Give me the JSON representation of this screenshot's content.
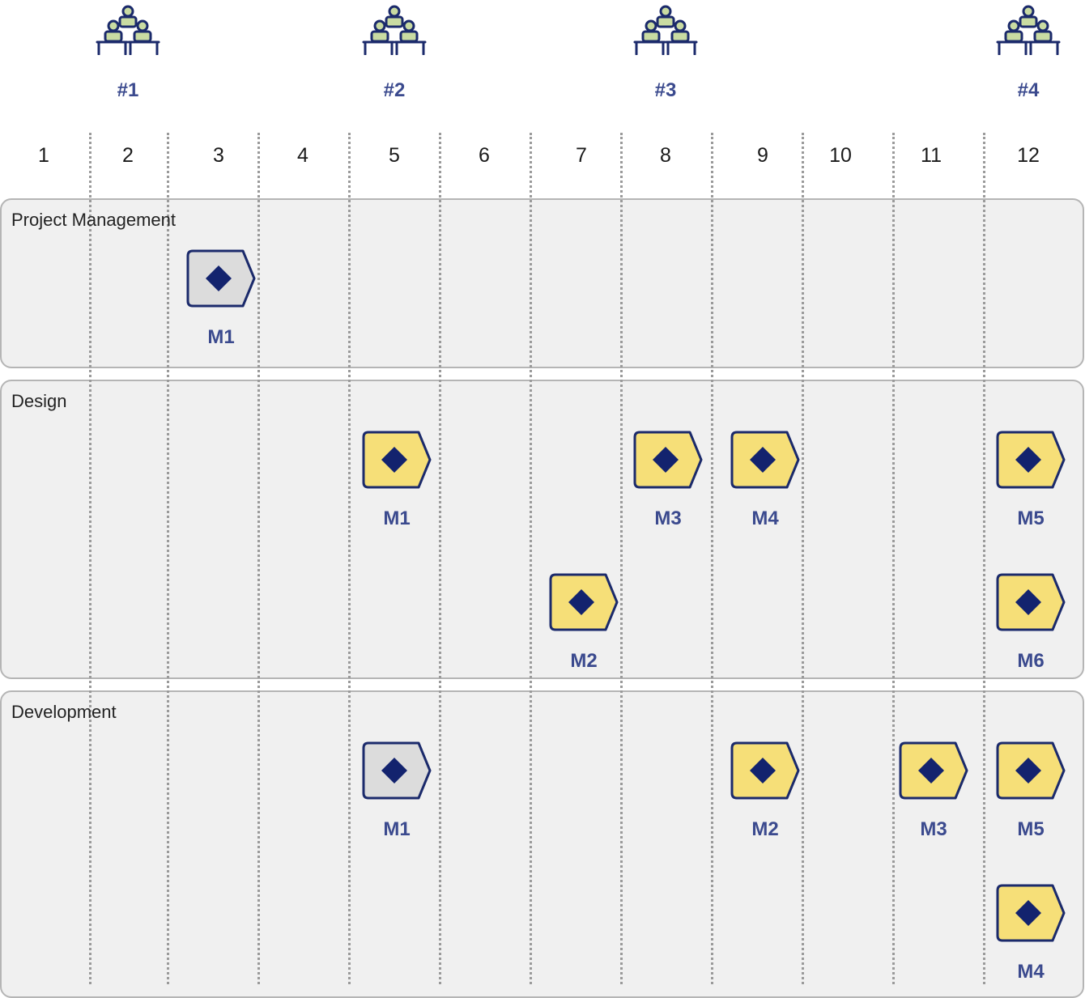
{
  "meetings": [
    {
      "label": "#1",
      "month": 2,
      "icon": "meeting-people-icon"
    },
    {
      "label": "#2",
      "month": 5,
      "icon": "meeting-people-icon"
    },
    {
      "label": "#3",
      "month": 8,
      "icon": "meeting-people-icon"
    },
    {
      "label": "#4",
      "month": 12,
      "icon": "meeting-people-icon"
    }
  ],
  "months": [
    "1",
    "2",
    "3",
    "4",
    "5",
    "6",
    "7",
    "8",
    "9",
    "10",
    "11",
    "12"
  ],
  "colors": {
    "done_fill": "#dcdcdc",
    "planned_fill": "#f6df78",
    "outline": "#1b2a6b",
    "diamond": "#13236e",
    "label": "#3b4a8e",
    "icon_fill": "#c9dba2",
    "icon_stroke": "#1b2a6b"
  },
  "lanes": [
    {
      "title": "Project Management",
      "rows": 1,
      "milestones": [
        {
          "label": "M1",
          "month": 3,
          "row": 0,
          "status": "done",
          "icon": "diamond-icon"
        }
      ]
    },
    {
      "title": "Design",
      "rows": 2,
      "milestones": [
        {
          "label": "M1",
          "month": 5,
          "row": 0,
          "status": "planned",
          "icon": "diamond-icon"
        },
        {
          "label": "M3",
          "month": 8,
          "row": 0,
          "status": "planned",
          "icon": "diamond-icon"
        },
        {
          "label": "M4",
          "month": 9,
          "row": 0,
          "status": "planned",
          "icon": "diamond-icon"
        },
        {
          "label": "M5",
          "month": 12,
          "row": 0,
          "status": "planned",
          "icon": "diamond-icon"
        },
        {
          "label": "M2",
          "month": 7,
          "row": 1,
          "status": "planned",
          "icon": "diamond-icon"
        },
        {
          "label": "M6",
          "month": 12,
          "row": 1,
          "status": "planned",
          "icon": "diamond-icon"
        }
      ]
    },
    {
      "title": "Development",
      "rows": 2,
      "milestones": [
        {
          "label": "M1",
          "month": 5,
          "row": 0,
          "status": "done",
          "icon": "diamond-icon"
        },
        {
          "label": "M2",
          "month": 9,
          "row": 0,
          "status": "planned",
          "icon": "diamond-icon"
        },
        {
          "label": "M3",
          "month": 11,
          "row": 0,
          "status": "planned",
          "icon": "diamond-icon"
        },
        {
          "label": "M5",
          "month": 12,
          "row": 0,
          "status": "planned",
          "icon": "diamond-icon"
        },
        {
          "label": "M4",
          "month": 12,
          "row": 1,
          "status": "planned",
          "icon": "diamond-icon"
        }
      ]
    }
  ]
}
